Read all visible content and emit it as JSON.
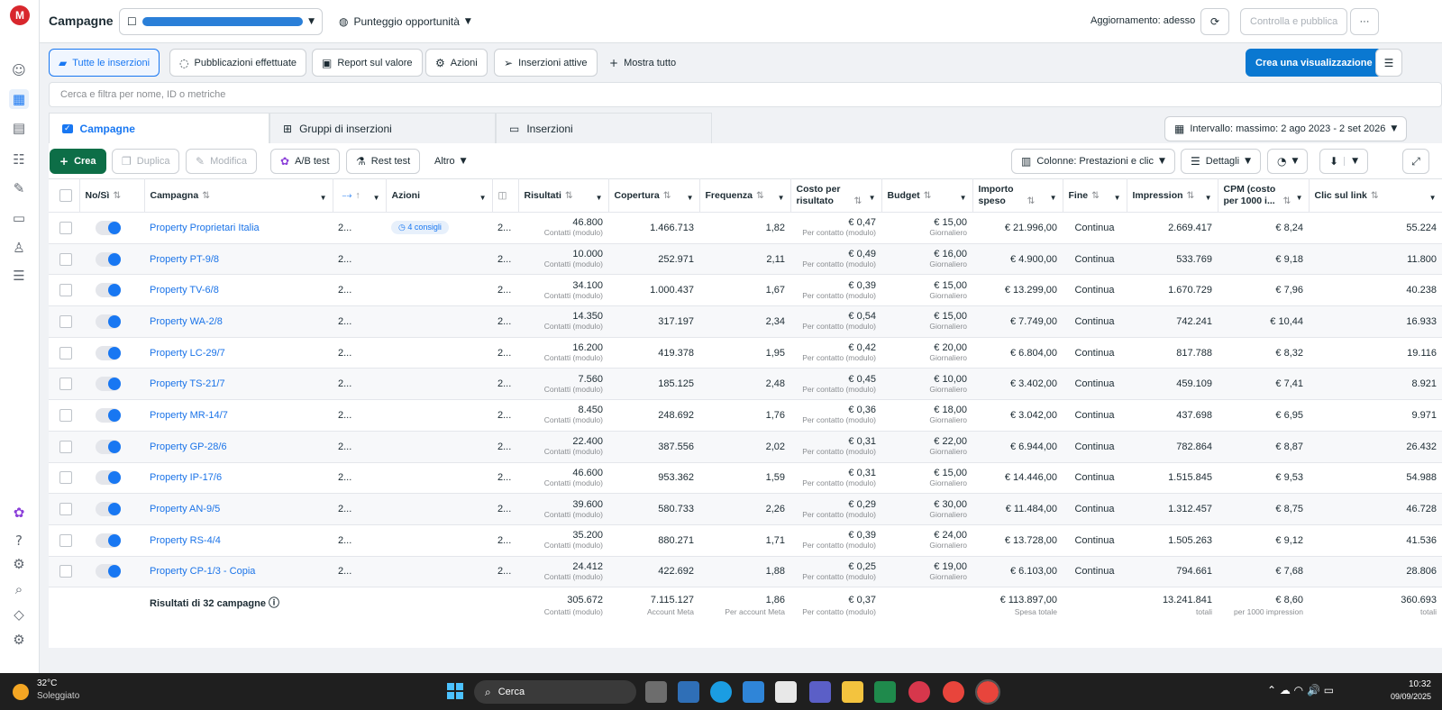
{
  "topbar": {
    "title": "Campagne",
    "score_label": "Punteggio opportunità",
    "updated": "Aggiornamento: adesso",
    "publish": "Controlla e pubblica",
    "more": "···"
  },
  "views": {
    "items": [
      "Tutte le inserzioni",
      "Pubblicazioni effettuate",
      "Report sul valore",
      "Azioni",
      "Inserzioni attive"
    ],
    "show_all": "Mostra tutto",
    "create_view": "Crea una visualizzazione"
  },
  "search": {
    "placeholder": "Cerca e filtra per nome, ID o metriche"
  },
  "tabs": [
    "Campagne",
    "Gruppi di inserzioni",
    "Inserzioni"
  ],
  "date_range": "Intervallo: massimo: 2 ago 2023 - 2 set 2026",
  "toolbar": {
    "create": "Crea",
    "duplicate": "Duplica",
    "edit": "Modifica",
    "ab_test": "A/B test",
    "rest_test": "Rest test",
    "other": "Altro",
    "columns": "Colonne: Prestazioni e clic",
    "breakdown": "Dettagli"
  },
  "columns": {
    "onoff": "No/Sì",
    "campaign": "Campagna",
    "actions": "Azioni",
    "results": "Risultati",
    "reach": "Copertura",
    "frequency": "Frequenza",
    "cpr": "Costo per risultato",
    "budget": "Budget",
    "spent": "Importo speso",
    "end": "Fine",
    "impressions": "Impression",
    "cpm": "CPM (costo per 1000 i...",
    "clicks": "Clic sul link"
  },
  "sublabels": {
    "results": "Contatti (modulo)",
    "cpr": "Per contatto (modulo)",
    "budget": "Giornaliero"
  },
  "rows": [
    {
      "name": "Property Proprietari Italia",
      "tip": "4 consigli",
      "results": "46.800",
      "reach": "1.466.713",
      "freq": "1,82",
      "cpr": "€ 0,47",
      "budget": "€ 15,00",
      "spent": "€ 21.996,00",
      "end": "Continua",
      "impr": "2.669.417",
      "cpm": "€ 8,24",
      "clicks": "55.224"
    },
    {
      "name": "Property PT-9/8",
      "tip": "",
      "results": "10.000",
      "reach": "252.971",
      "freq": "2,11",
      "cpr": "€ 0,49",
      "budget": "€ 16,00",
      "spent": "€ 4.900,00",
      "end": "Continua",
      "impr": "533.769",
      "cpm": "€ 9,18",
      "clicks": "11.800"
    },
    {
      "name": "Property TV-6/8",
      "tip": "",
      "results": "34.100",
      "reach": "1.000.437",
      "freq": "1,67",
      "cpr": "€ 0,39",
      "budget": "€ 15,00",
      "spent": "€ 13.299,00",
      "end": "Continua",
      "impr": "1.670.729",
      "cpm": "€ 7,96",
      "clicks": "40.238"
    },
    {
      "name": "Property WA-2/8",
      "tip": "",
      "results": "14.350",
      "reach": "317.197",
      "freq": "2,34",
      "cpr": "€ 0,54",
      "budget": "€ 15,00",
      "spent": "€ 7.749,00",
      "end": "Continua",
      "impr": "742.241",
      "cpm": "€ 10,44",
      "clicks": "16.933"
    },
    {
      "name": "Property LC-29/7",
      "tip": "",
      "results": "16.200",
      "reach": "419.378",
      "freq": "1,95",
      "cpr": "€ 0,42",
      "budget": "€ 20,00",
      "spent": "€ 6.804,00",
      "end": "Continua",
      "impr": "817.788",
      "cpm": "€ 8,32",
      "clicks": "19.116"
    },
    {
      "name": "Property TS-21/7",
      "tip": "",
      "results": "7.560",
      "reach": "185.125",
      "freq": "2,48",
      "cpr": "€ 0,45",
      "budget": "€ 10,00",
      "spent": "€ 3.402,00",
      "end": "Continua",
      "impr": "459.109",
      "cpm": "€ 7,41",
      "clicks": "8.921"
    },
    {
      "name": "Property MR-14/7",
      "tip": "",
      "results": "8.450",
      "reach": "248.692",
      "freq": "1,76",
      "cpr": "€ 0,36",
      "budget": "€ 18,00",
      "spent": "€ 3.042,00",
      "end": "Continua",
      "impr": "437.698",
      "cpm": "€ 6,95",
      "clicks": "9.971"
    },
    {
      "name": "Property GP-28/6",
      "tip": "",
      "results": "22.400",
      "reach": "387.556",
      "freq": "2,02",
      "cpr": "€ 0,31",
      "budget": "€ 22,00",
      "spent": "€ 6.944,00",
      "end": "Continua",
      "impr": "782.864",
      "cpm": "€ 8,87",
      "clicks": "26.432"
    },
    {
      "name": "Property IP-17/6",
      "tip": "",
      "results": "46.600",
      "reach": "953.362",
      "freq": "1,59",
      "cpr": "€ 0,31",
      "budget": "€ 15,00",
      "spent": "€ 14.446,00",
      "end": "Continua",
      "impr": "1.515.845",
      "cpm": "€ 9,53",
      "clicks": "54.988"
    },
    {
      "name": "Property AN-9/5",
      "tip": "",
      "results": "39.600",
      "reach": "580.733",
      "freq": "2,26",
      "cpr": "€ 0,29",
      "budget": "€ 30,00",
      "spent": "€ 11.484,00",
      "end": "Continua",
      "impr": "1.312.457",
      "cpm": "€ 8,75",
      "clicks": "46.728"
    },
    {
      "name": "Property RS-4/4",
      "tip": "",
      "results": "35.200",
      "reach": "880.271",
      "freq": "1,71",
      "cpr": "€ 0,39",
      "budget": "€ 24,00",
      "spent": "€ 13.728,00",
      "end": "Continua",
      "impr": "1.505.263",
      "cpm": "€ 9,12",
      "clicks": "41.536"
    },
    {
      "name": "Property CP-1/3 - Copia",
      "tip": "",
      "results": "24.412",
      "reach": "422.692",
      "freq": "1,88",
      "cpr": "€ 0,25",
      "budget": "€ 19,00",
      "spent": "€ 6.103,00",
      "end": "Continua",
      "impr": "794.661",
      "cpm": "€ 7,68",
      "clicks": "28.806"
    }
  ],
  "totals": {
    "label": "Risultati di 32 campagne",
    "results": "305.672",
    "results_sub": "Contatti (modulo)",
    "reach": "7.115.127",
    "reach_sub": "Account Meta",
    "freq": "1,86",
    "freq_sub": "Per account Meta",
    "cpr": "€ 0,37",
    "cpr_sub": "Per contatto (modulo)",
    "spent": "€ 113.897,00",
    "spent_sub": "Spesa totale",
    "impr": "13.241.841",
    "impr_sub": "totali",
    "cpm": "€ 8,60",
    "cpm_sub": "per 1000 impression",
    "clicks": "360.693",
    "clicks_sub": "totali"
  },
  "taskbar": {
    "temp": "32°C",
    "weather": "Soleggiato",
    "search": "Cerca",
    "time": "10:32",
    "date": "09/09/2025"
  }
}
